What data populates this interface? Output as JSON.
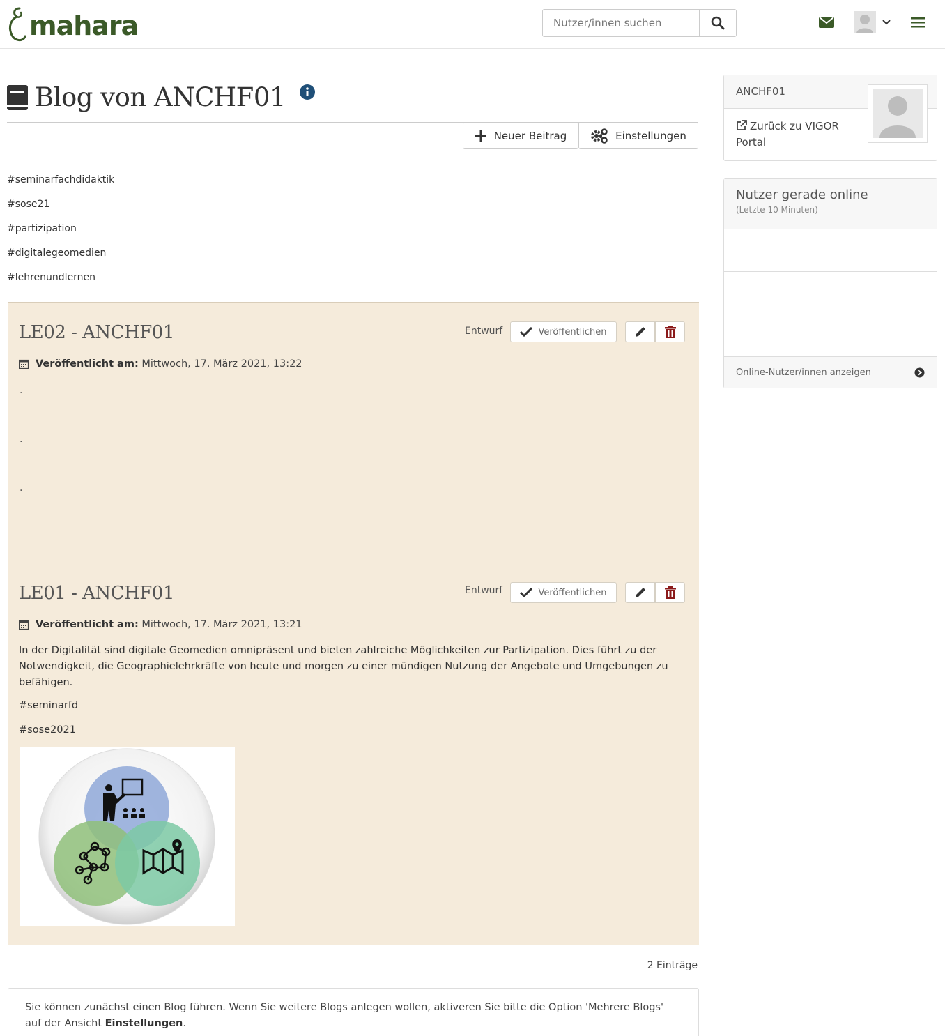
{
  "header": {
    "logo_text": "mahara",
    "search_placeholder": "Nutzer/innen suchen",
    "icons": [
      "search-icon",
      "mail-icon",
      "user-icon",
      "chevron-down-icon",
      "menu-icon"
    ],
    "brand_color": "#3b5a28"
  },
  "page": {
    "title": "Blog von ANCHF01",
    "new_post_label": "Neuer Beitrag",
    "settings_label": "Einstellungen",
    "tags": [
      "#seminarfachdidaktik",
      "#sose21",
      "#partizipation",
      "#digitalegeomedien",
      "#lehrenundlernen"
    ]
  },
  "posts": [
    {
      "title": "LE02 - ANCHF01",
      "status": "Entwurf",
      "publish_label": "Veröffentlichen",
      "published_label": "Veröffentlicht am:",
      "published_date": "Mittwoch, 17. März 2021, 13:22",
      "body_lines": [
        ".",
        ".",
        "."
      ]
    },
    {
      "title": "LE01 - ANCHF01",
      "status": "Entwurf",
      "publish_label": "Veröffentlichen",
      "published_label": "Veröffentlicht am:",
      "published_date": "Mittwoch, 17. März 2021, 13:21",
      "body": "In der Digitalität sind digitale Geomedien omnipräsent und bieten zahlreiche Möglichkeiten zur Partizipation. Dies führt zu der Notwendigkeit, die Geographielehrkräfte von heute und morgen zu einer mündigen Nutzung der Angebote und Umgebungen zu befähigen.",
      "tags": [
        "#seminarfd",
        "#sose2021"
      ],
      "image_colors": [
        "#8fa8d8",
        "#8fc07a",
        "#7cc9a4"
      ]
    }
  ],
  "footer": {
    "count": "2 Einträge",
    "info_text": "Sie können zunächst einen Blog führen. Wenn Sie weitere Blogs anlegen wollen, aktiveren Sie bitte die Option 'Mehrere Blogs' auf der Ansicht ",
    "info_bold": "Einstellungen",
    "info_end": "."
  },
  "sidebar": {
    "user_name": "ANCHF01",
    "back_link": "Zurück zu VIGOR Portal",
    "online_title": "Nutzer gerade online",
    "online_sub": "(Letzte 10 Minuten)",
    "online_link": "Online-Nutzer/innen anzeigen"
  },
  "colors": {
    "post_bg": "#f5ebdb",
    "delete_red": "#8b1a1a",
    "info_blue": "#1f4f78"
  }
}
